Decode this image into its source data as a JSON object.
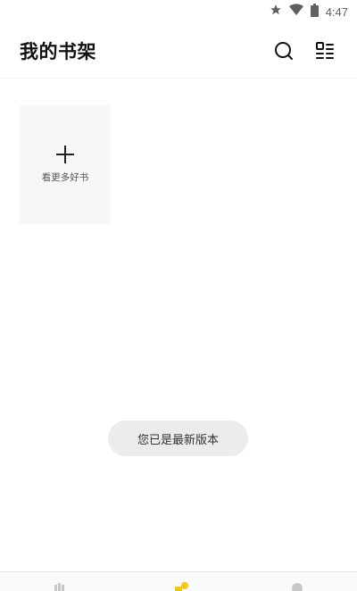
{
  "status_bar": {
    "time": "4:47",
    "icons": [
      "star-icon",
      "wifi-icon",
      "battery-icon"
    ]
  },
  "header": {
    "title": "我的书架",
    "icons": [
      "search-icon",
      "list-icon"
    ]
  },
  "shelf": {
    "add_card_label": "看更多好书"
  },
  "toast": {
    "text": "您已是最新版本"
  },
  "bottom_nav": {
    "items": [
      "bookstore-icon",
      "bookshelf-icon",
      "profile-icon"
    ],
    "active_color": "#f5c518"
  }
}
